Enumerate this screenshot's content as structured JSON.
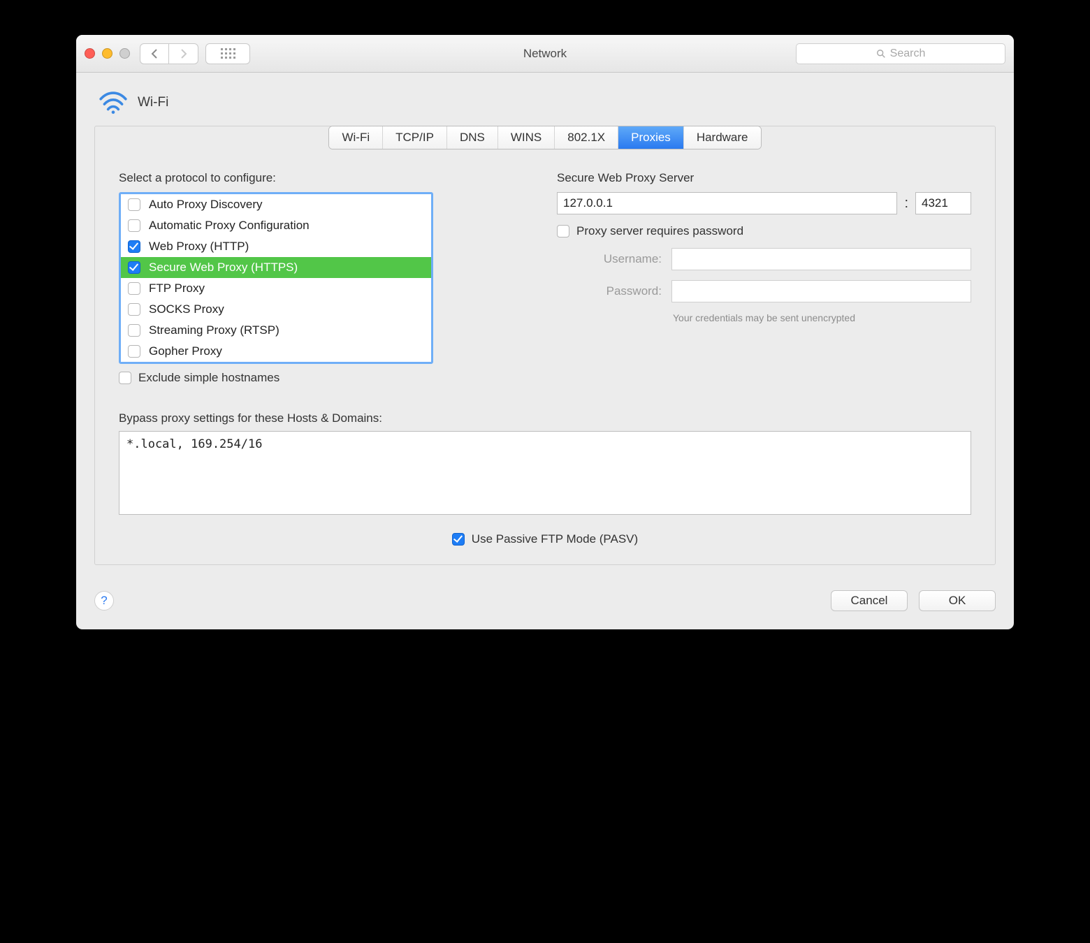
{
  "titlebar": {
    "title": "Network",
    "search_placeholder": "Search"
  },
  "header": {
    "interface": "Wi-Fi"
  },
  "tabs": [
    {
      "label": "Wi-Fi",
      "selected": false
    },
    {
      "label": "TCP/IP",
      "selected": false
    },
    {
      "label": "DNS",
      "selected": false
    },
    {
      "label": "WINS",
      "selected": false
    },
    {
      "label": "802.1X",
      "selected": false
    },
    {
      "label": "Proxies",
      "selected": true
    },
    {
      "label": "Hardware",
      "selected": false
    }
  ],
  "proxy": {
    "protocol_label": "Select a protocol to configure:",
    "protocols": [
      {
        "label": "Auto Proxy Discovery",
        "checked": false,
        "selected": false
      },
      {
        "label": "Automatic Proxy Configuration",
        "checked": false,
        "selected": false
      },
      {
        "label": "Web Proxy (HTTP)",
        "checked": true,
        "selected": false
      },
      {
        "label": "Secure Web Proxy (HTTPS)",
        "checked": true,
        "selected": true
      },
      {
        "label": "FTP Proxy",
        "checked": false,
        "selected": false
      },
      {
        "label": "SOCKS Proxy",
        "checked": false,
        "selected": false
      },
      {
        "label": "Streaming Proxy (RTSP)",
        "checked": false,
        "selected": false
      },
      {
        "label": "Gopher Proxy",
        "checked": false,
        "selected": false
      }
    ],
    "server_label": "Secure Web Proxy Server",
    "server_host": "127.0.0.1",
    "server_port": "4321",
    "requires_password_label": "Proxy server requires password",
    "requires_password_checked": false,
    "username_label": "Username:",
    "username_value": "",
    "password_label": "Password:",
    "password_value": "",
    "credentials_note": "Your credentials may be sent unencrypted",
    "exclude_simple_label": "Exclude simple hostnames",
    "exclude_simple_checked": false,
    "bypass_label": "Bypass proxy settings for these Hosts & Domains:",
    "bypass_value": "*.local, 169.254/16",
    "pasv_label": "Use Passive FTP Mode (PASV)",
    "pasv_checked": true
  },
  "footer": {
    "cancel": "Cancel",
    "ok": "OK"
  }
}
